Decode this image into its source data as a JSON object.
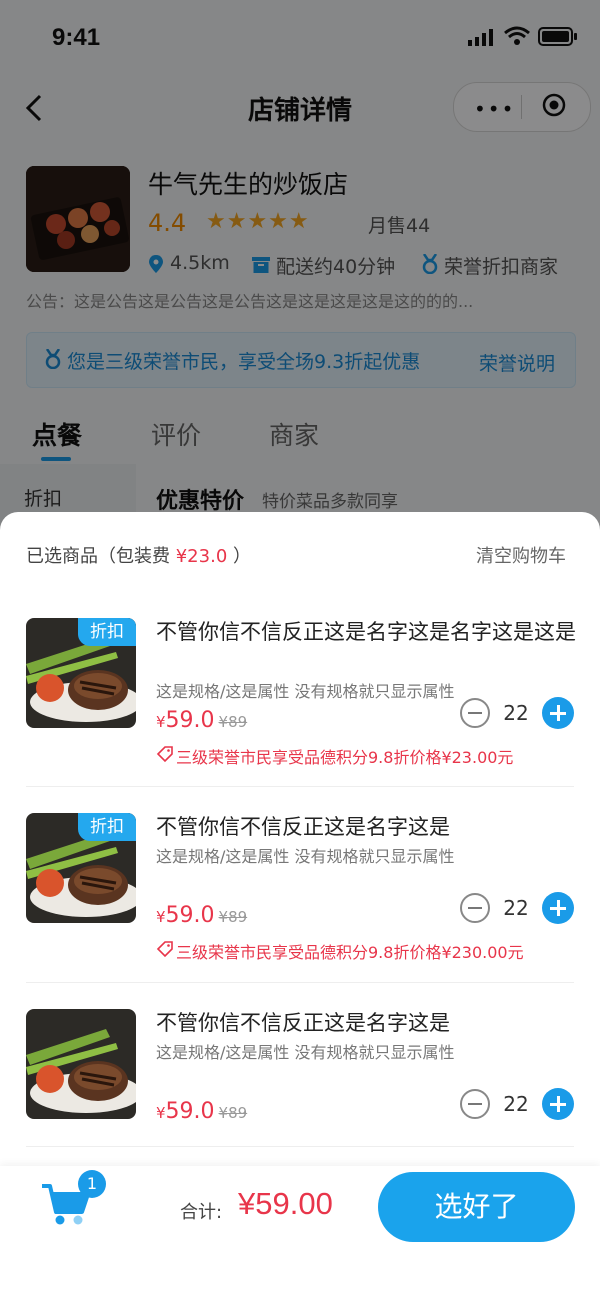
{
  "status_bar": {
    "time": "9:41"
  },
  "nav": {
    "title": "店铺详情"
  },
  "shop": {
    "name": "牛气先生的炒饭店",
    "rating": "4.4",
    "stars": "★★★★★",
    "monthly_sales": "月售44",
    "distance": "4.5km",
    "delivery": "配送约40分钟",
    "honor_merchant": "荣誉折扣商家",
    "notice": "公告：这是公告这是公告这是公告这是这是这是这是这的的的..."
  },
  "honor_banner": {
    "text": "您是三级荣誉市民，享受全场9.3折起优惠",
    "link": "荣誉说明"
  },
  "tabs": [
    {
      "label": "点餐"
    },
    {
      "label": "评价"
    },
    {
      "label": "商家"
    }
  ],
  "menu": {
    "category": "折扣",
    "section_title": "优惠特价",
    "section_subtitle": "特价菜品多款同享"
  },
  "cart": {
    "header_prefix": "已选商品（包装费",
    "fee": "¥23.0",
    "header_suffix": "）",
    "clear_label": "清空购物车",
    "items": [
      {
        "badge": "折扣",
        "name": "不管你信不信反正这是名字这是名字这是这是",
        "spec": "这是规格/这是属性 没有规格就只显示属性",
        "currency": "¥",
        "price": "59.0",
        "original_price": "¥89",
        "promo": "三级荣誉市民享受品德积分9.8折价格¥23.00元",
        "quantity": "22"
      },
      {
        "badge": "折扣",
        "name": "不管你信不信反正这是名字这是",
        "spec": "这是规格/这是属性 没有规格就只显示属性",
        "currency": "¥",
        "price": "59.0",
        "original_price": "¥89",
        "promo": "三级荣誉市民享受品德积分9.8折价格¥230.00元",
        "quantity": "22"
      },
      {
        "badge": "",
        "name": "不管你信不信反正这是名字这是",
        "spec": "这是规格/这是属性 没有规格就只显示属性",
        "currency": "¥",
        "price": "59.0",
        "original_price": "¥89",
        "promo": "",
        "quantity": "22"
      }
    ]
  },
  "footer": {
    "cart_count": "1",
    "total_label": "合计:",
    "total": "¥59.00",
    "checkout_label": "选好了"
  },
  "colors": {
    "accent": "#1a9be8",
    "price": "#e8354a",
    "rating": "#f08a00"
  }
}
